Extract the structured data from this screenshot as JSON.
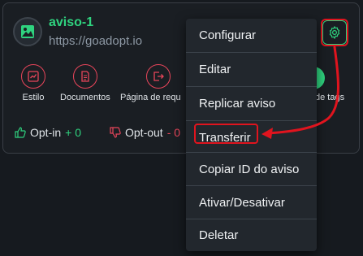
{
  "card": {
    "title": "aviso-1",
    "url": "https://goadopt.io",
    "actions": [
      {
        "label": "Estilo",
        "icon": "chart-icon"
      },
      {
        "label": "Documentos",
        "icon": "document-icon"
      },
      {
        "label": "Página de requ",
        "icon": "exit-icon"
      },
      {
        "label": "de tags",
        "icon": "tags-icon"
      }
    ],
    "optin_label": "Opt-in",
    "optin_value": "+ 0",
    "optout_label": "Opt-out",
    "optout_value": "- 0"
  },
  "menu": {
    "items": [
      "Configurar",
      "Editar",
      "Replicar aviso",
      "Transferir",
      "Copiar ID do aviso",
      "Ativar/Desativar",
      "Deletar"
    ]
  },
  "colors": {
    "accent_green": "#2fd37f",
    "accent_red": "#e8455a",
    "highlight_red": "#e0141e",
    "background": "#161a1f",
    "menu_bg": "#22272d"
  }
}
